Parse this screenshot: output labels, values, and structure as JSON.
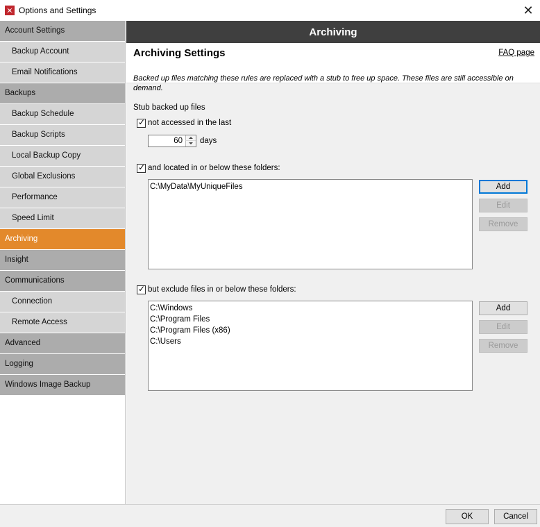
{
  "window": {
    "title": "Options and Settings",
    "close_glyph": "✕",
    "app_icon": "app-logo-icon",
    "accent_color": "#e3892b"
  },
  "sidebar": {
    "items": [
      {
        "label": "Account Settings",
        "level": "category",
        "active": false
      },
      {
        "label": "Backup Account",
        "level": "sub",
        "active": false
      },
      {
        "label": "Email Notifications",
        "level": "sub",
        "active": false
      },
      {
        "label": "Backups",
        "level": "category",
        "active": false
      },
      {
        "label": "Backup Schedule",
        "level": "sub",
        "active": false
      },
      {
        "label": "Backup Scripts",
        "level": "sub",
        "active": false
      },
      {
        "label": "Local Backup Copy",
        "level": "sub",
        "active": false
      },
      {
        "label": "Global Exclusions",
        "level": "sub",
        "active": false
      },
      {
        "label": "Performance",
        "level": "sub",
        "active": false
      },
      {
        "label": "Speed Limit",
        "level": "sub",
        "active": false
      },
      {
        "label": "Archiving",
        "level": "category",
        "active": true
      },
      {
        "label": "Insight",
        "level": "category",
        "active": false
      },
      {
        "label": "Communications",
        "level": "category",
        "active": false
      },
      {
        "label": "Connection",
        "level": "sub",
        "active": false
      },
      {
        "label": "Remote Access",
        "level": "sub",
        "active": false
      },
      {
        "label": "Advanced",
        "level": "category",
        "active": false
      },
      {
        "label": "Logging",
        "level": "category",
        "active": false
      },
      {
        "label": "Windows Image Backup",
        "level": "category",
        "active": false
      }
    ]
  },
  "main": {
    "header": "Archiving",
    "section_title": "Archiving Settings",
    "faq_link": "FAQ page",
    "description": "Backed up files matching these rules are replaced with a stub to free up space. These files are still accessible on demand.",
    "stub_label": "Stub backed up files",
    "not_accessed": {
      "checked": true,
      "label": "not accessed in the last"
    },
    "days": {
      "value": "60",
      "unit": "days"
    },
    "include_folders": {
      "checked": true,
      "label": "and located in or below these folders:",
      "items": [
        "C:\\MyData\\MyUniqueFiles"
      ]
    },
    "exclude_folders": {
      "checked": true,
      "label": "but exclude files in or below these folders:",
      "items": [
        "C:\\Windows",
        "C:\\Program Files",
        "C:\\Program Files (x86)",
        "C:\\Users"
      ]
    },
    "buttons": {
      "add": "Add",
      "edit": "Edit",
      "remove": "Remove"
    }
  },
  "footer": {
    "ok": "OK",
    "cancel": "Cancel"
  }
}
